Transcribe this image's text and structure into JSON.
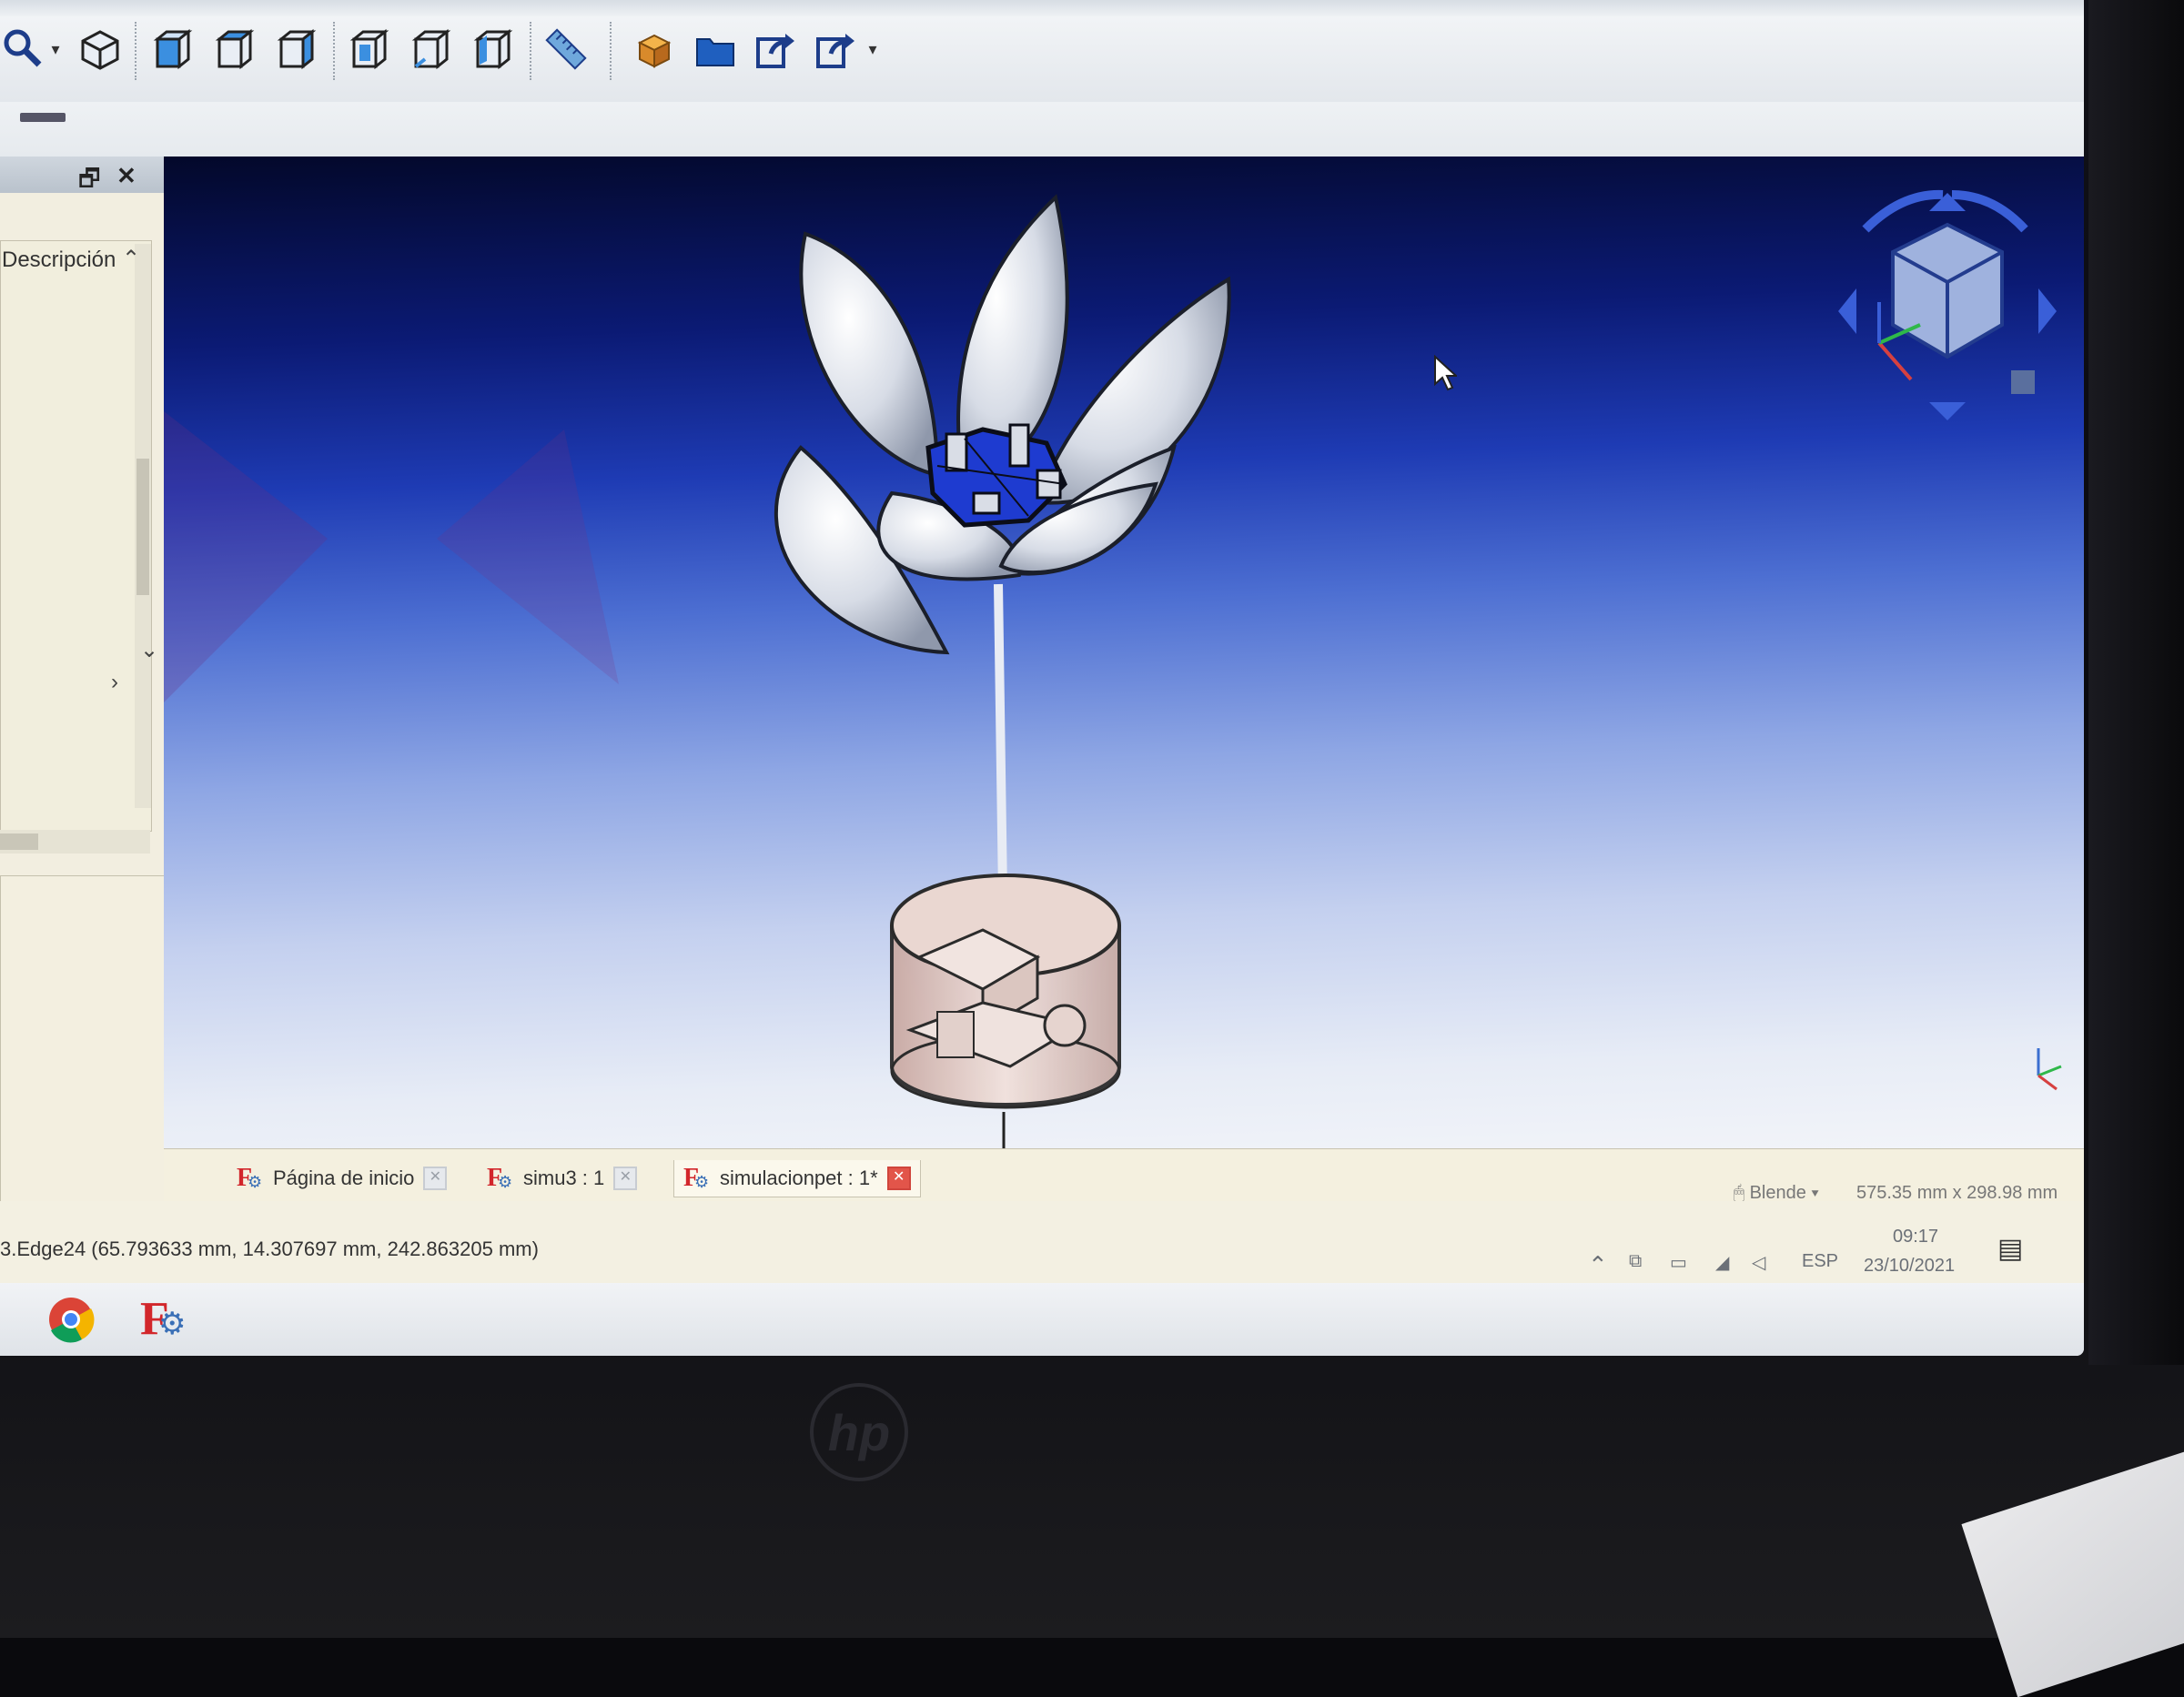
{
  "toolbar": {
    "tools": [
      "zoom-tool-icon",
      "isometric-view-icon",
      "front-view-icon",
      "top-view-icon",
      "right-view-icon",
      "rear-view-icon",
      "bottom-view-icon",
      "left-view-icon",
      "measure-icon",
      "part-icon",
      "open-folder-icon",
      "export-icon",
      "share-icon"
    ]
  },
  "left_panel": {
    "description_label": "Descripción"
  },
  "tabs": [
    {
      "label": "Página de inicio",
      "active": false
    },
    {
      "label": "simu3 : 1",
      "active": false
    },
    {
      "label": "simulacionpet : 1*",
      "active": true
    }
  ],
  "view": {
    "navigation_style": "Blende",
    "dimensions": "575.35 mm x 298.98 mm"
  },
  "status": {
    "text": "3.Edge24 (65.793633 mm, 14.307697 mm, 242.863205 mm)"
  },
  "tray": {
    "language": "ESP",
    "time": "09:17",
    "date": "23/10/2021"
  },
  "colors": {
    "view_top": "#03082a",
    "view_bottom": "#f2f4f9",
    "freecad_red": "#d2262b",
    "active_tab_close": "#e2554a"
  }
}
